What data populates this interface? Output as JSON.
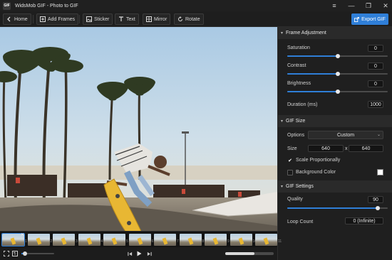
{
  "window": {
    "logo_text": "GIF",
    "title": "WidsMob GIF - Photo to GIF",
    "controls": [
      "≡",
      "—",
      "❐",
      "✕"
    ]
  },
  "toolbar": {
    "home": "Home",
    "add_frames": "Add Frames",
    "sticker": "Sticker",
    "text": "Text",
    "mirror": "Mirror",
    "rotate": "Rotate",
    "export": "Export GIF"
  },
  "panel": {
    "frame_adjustment": {
      "title": "Frame Adjustment",
      "saturation_label": "Saturation",
      "saturation_value": "0",
      "saturation_level": 0.5,
      "contrast_label": "Contrast",
      "contrast_value": "0",
      "contrast_level": 0.5,
      "brightness_label": "Brightness",
      "brightness_value": "0",
      "brightness_level": 0.5,
      "duration_label": "Duration (ms)",
      "duration_value": "1000"
    },
    "gif_size": {
      "title": "GIF Size",
      "options_label": "Options",
      "options_value": "Custom",
      "size_label": "Size",
      "width": "640",
      "separator": "x",
      "height": "640",
      "scale_label": "Scale Proportionally",
      "scale_checked": true,
      "background_label": "Background Color",
      "background_checked": false,
      "background_color": "#ffffff"
    },
    "gif_settings": {
      "title": "GIF Settings",
      "quality_label": "Quality",
      "quality_value": "90",
      "quality_level": 0.9,
      "loop_label": "Loop Count",
      "loop_value": "0 (Infinite)"
    }
  },
  "filmstrip": {
    "frames": [
      "1",
      "2",
      "3",
      "4",
      "5",
      "6",
      "7",
      "8",
      "9",
      "10",
      "11"
    ],
    "selected": 0
  },
  "playback": {
    "progress": 0.1,
    "speed_level": 0.6
  },
  "colors": {
    "accent": "#2f7fd8",
    "panel_bg": "#1f1f1f",
    "section_bg": "#2a2a2a"
  }
}
